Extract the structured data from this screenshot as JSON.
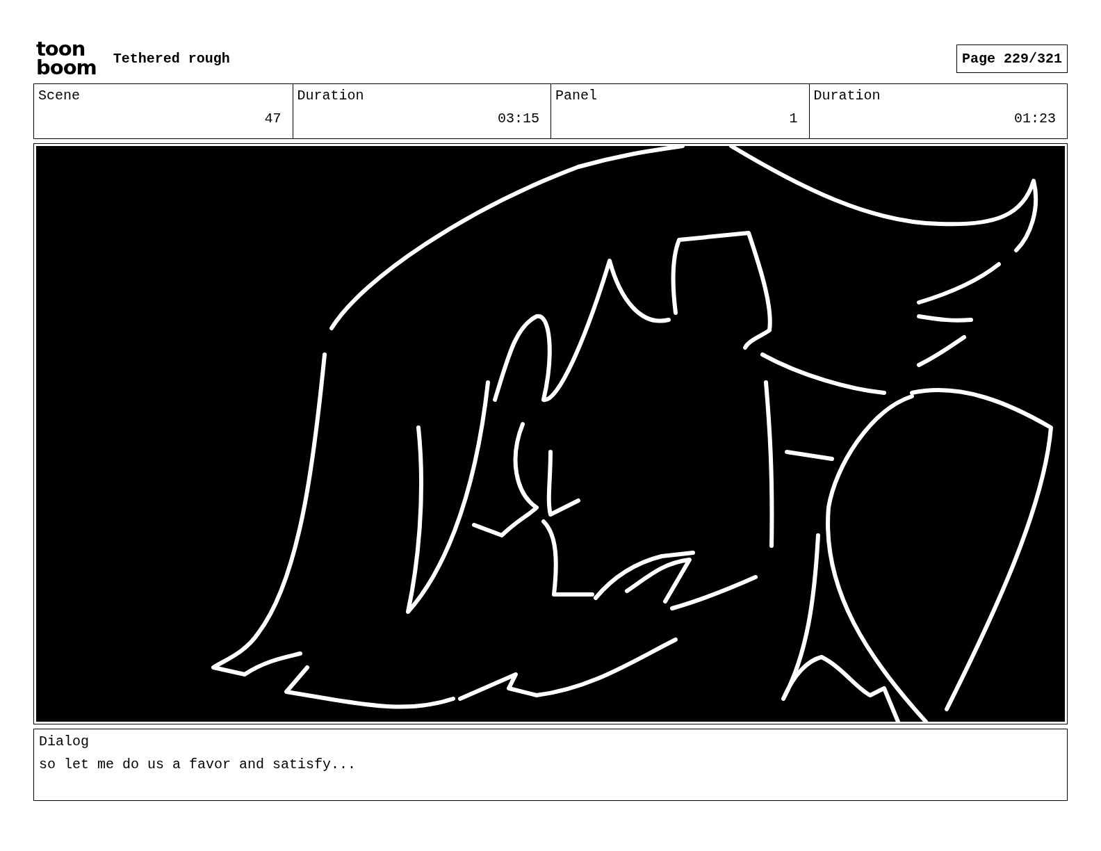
{
  "header": {
    "logo": [
      "toon",
      "boom"
    ],
    "title": "Tethered rough",
    "page": "Page 229/321"
  },
  "info": [
    {
      "label": "Scene",
      "value": "47"
    },
    {
      "label": "Duration",
      "value": "03:15"
    },
    {
      "label": "Panel",
      "value": "1"
    },
    {
      "label": "Duration",
      "value": "01:23"
    }
  ],
  "dialog": {
    "label": "Dialog",
    "text": "so let me do us a favor and satisfy..."
  }
}
